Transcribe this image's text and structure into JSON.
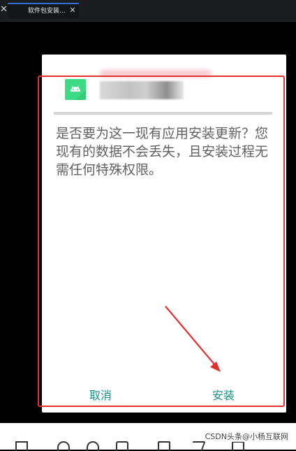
{
  "tabbar": {
    "left_close_glyph": "✕",
    "tab_title": "软件包安装...",
    "tab_close_glyph": "✕"
  },
  "dialog": {
    "app_icon": "android-icon",
    "message": "是否要为这一现有应用安装更新？您现有的数据不会丢失，且安装过程无需任何特殊权限。",
    "cancel_label": "取消",
    "install_label": "安装"
  },
  "colors": {
    "accent": "#1a8f85",
    "annotation": "#e23030",
    "android_green": "#3ddc84"
  },
  "watermark": "CSDN头条@小杨互联网"
}
